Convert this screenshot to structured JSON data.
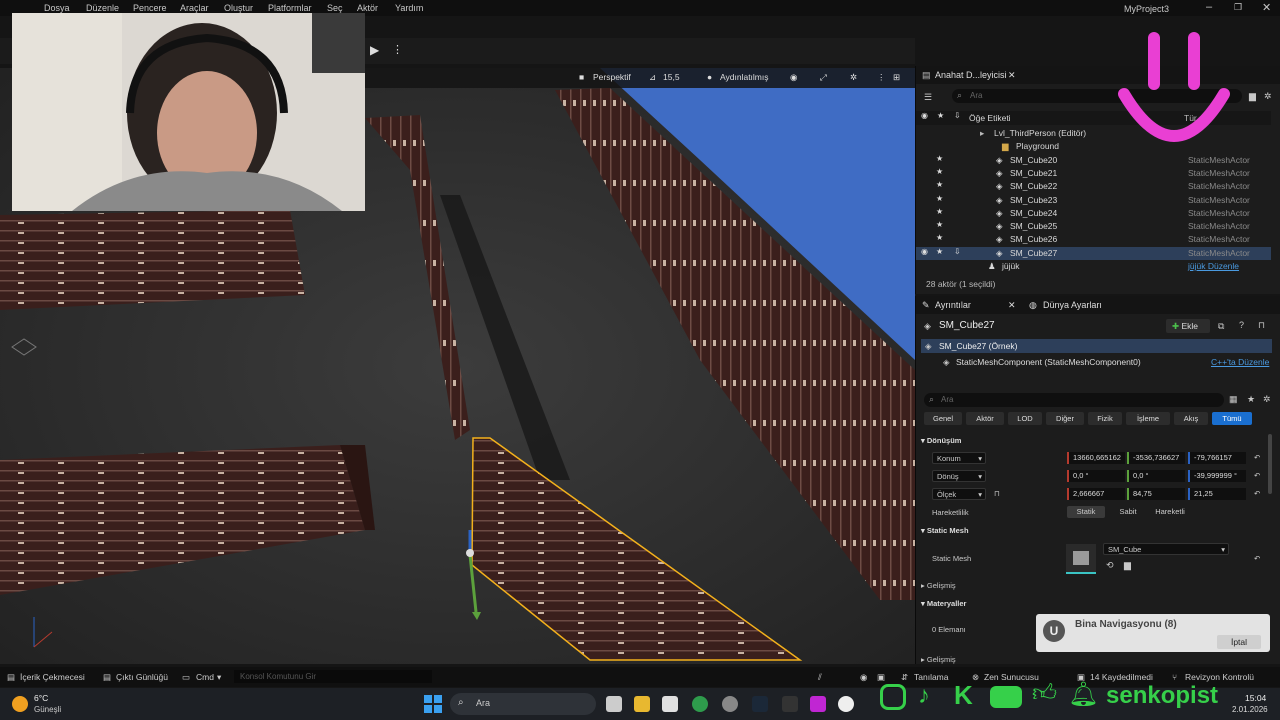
{
  "menu": [
    "Dosya",
    "Düzenle",
    "Pencere",
    "Araçlar",
    "Oluştur",
    "Platformlar",
    "Seç",
    "Aktör",
    "Yardım"
  ],
  "project_title": "MyProject3",
  "viewport": {
    "perspective": "Perspektif",
    "fov": "15,5",
    "lit": "Aydınlatılmış"
  },
  "outliner": {
    "tab": "Anahat D...leyicisi",
    "search_placeholder": "Ara",
    "col_label": "Öğe Etiketi",
    "col_type": "Tür",
    "level": "Lvl_ThirdPerson (Editör)",
    "folder": "Playground",
    "rows": [
      {
        "name": "SM_Cube20",
        "type": "StaticMeshActor"
      },
      {
        "name": "SM_Cube21",
        "type": "StaticMeshActor"
      },
      {
        "name": "SM_Cube22",
        "type": "StaticMeshActor"
      },
      {
        "name": "SM_Cube23",
        "type": "StaticMeshActor"
      },
      {
        "name": "SM_Cube24",
        "type": "StaticMeshActor"
      },
      {
        "name": "SM_Cube25",
        "type": "StaticMeshActor"
      },
      {
        "name": "SM_Cube26",
        "type": "StaticMeshActor"
      },
      {
        "name": "SM_Cube27",
        "type": "StaticMeshActor"
      }
    ],
    "last_name": "jüjük",
    "last_type": "jüjük Düzenle",
    "footer": "28 aktör (1 seçildi)"
  },
  "details": {
    "tab": "Ayrıntılar",
    "tab2": "Dünya Ayarları",
    "actor": "SM_Cube27",
    "add": "Ekle",
    "instance": "SM_Cube27 (Örnek)",
    "component": "StaticMeshComponent (StaticMeshComponent0)",
    "cpp": "C++'ta Düzenle",
    "search_placeholder": "Ara",
    "categories": [
      "Genel",
      "Aktör",
      "LOD",
      "Diğer",
      "Fizik",
      "İşleme",
      "Akış",
      "Tümü"
    ],
    "transform_header": "Dönüşüm",
    "location_label": "Konum",
    "location": [
      "13660,665162",
      "-3536,736627",
      "-79,766157"
    ],
    "rotation_label": "Dönüş",
    "rotation": [
      "0,0 °",
      "0,0 °",
      "-39,999999 °"
    ],
    "scale_label": "Ölçek",
    "scale": [
      "2,666667",
      "84,75",
      "21,25"
    ],
    "mobility_label": "Hareketlilik",
    "mobility": [
      "Statik",
      "Sabit",
      "Hareketli"
    ],
    "static_mesh_header": "Static Mesh",
    "static_mesh_label": "Static Mesh",
    "static_mesh_value": "SM_Cube",
    "advanced": "Gelişmiş",
    "materials_header": "Materyaller",
    "element0": "0 Elemanı",
    "advanced2": "Gelişmiş"
  },
  "notification": {
    "title": "Bina Navigasyonu (8)",
    "cancel": "İptal"
  },
  "statusbar": {
    "content": "İçerik Çekmecesi",
    "log": "Çıktı Günlüğü",
    "cmd": "Cmd",
    "console_placeholder": "Konsol Komutunu Gir",
    "trace": "Tanılama",
    "zen": "Zen Sunucusu",
    "saved": "14 Kaydedilmedi",
    "revision": "Revizyon Kontrolü"
  },
  "taskbar": {
    "weather_temp": "6°C",
    "weather_desc": "Güneşli",
    "search": "Ara",
    "time": "15:04",
    "date": "2.01.2026"
  },
  "overlay": {
    "brand": "senkopist"
  },
  "colors": {
    "accent": "#1a6fd0",
    "selection": "#2d3f5a",
    "highlight": "#f3b11c",
    "smiley": "#e93fd3"
  }
}
